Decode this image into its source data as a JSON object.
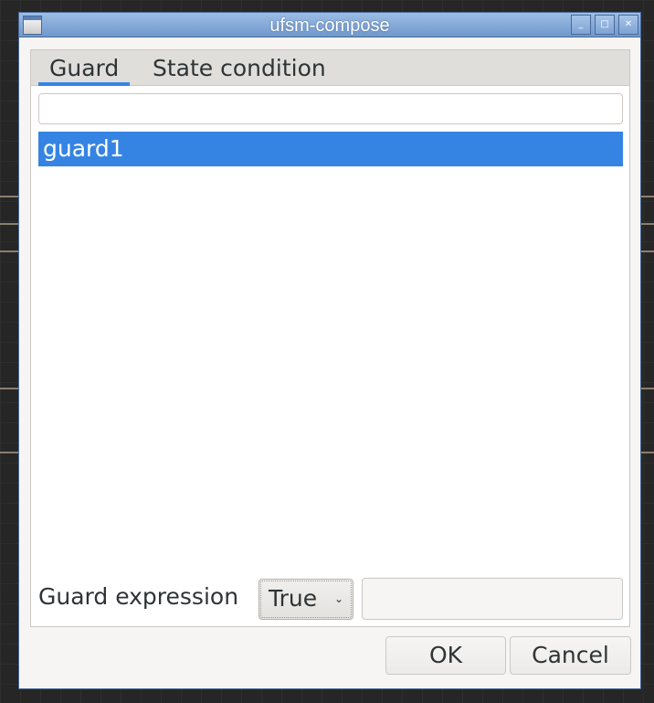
{
  "window": {
    "title": "ufsm-compose"
  },
  "tabs": [
    {
      "label": "Guard",
      "active": true
    },
    {
      "label": "State condition",
      "active": false
    }
  ],
  "search": {
    "value": ""
  },
  "list": {
    "items": [
      {
        "label": "guard1",
        "selected": true
      }
    ]
  },
  "guard_expression": {
    "label": "Guard expression",
    "selected_value": "True",
    "expression_value": ""
  },
  "buttons": {
    "ok": "OK",
    "cancel": "Cancel"
  },
  "colors": {
    "accent": "#3584e4",
    "titlebar": "#7ea3d3"
  }
}
